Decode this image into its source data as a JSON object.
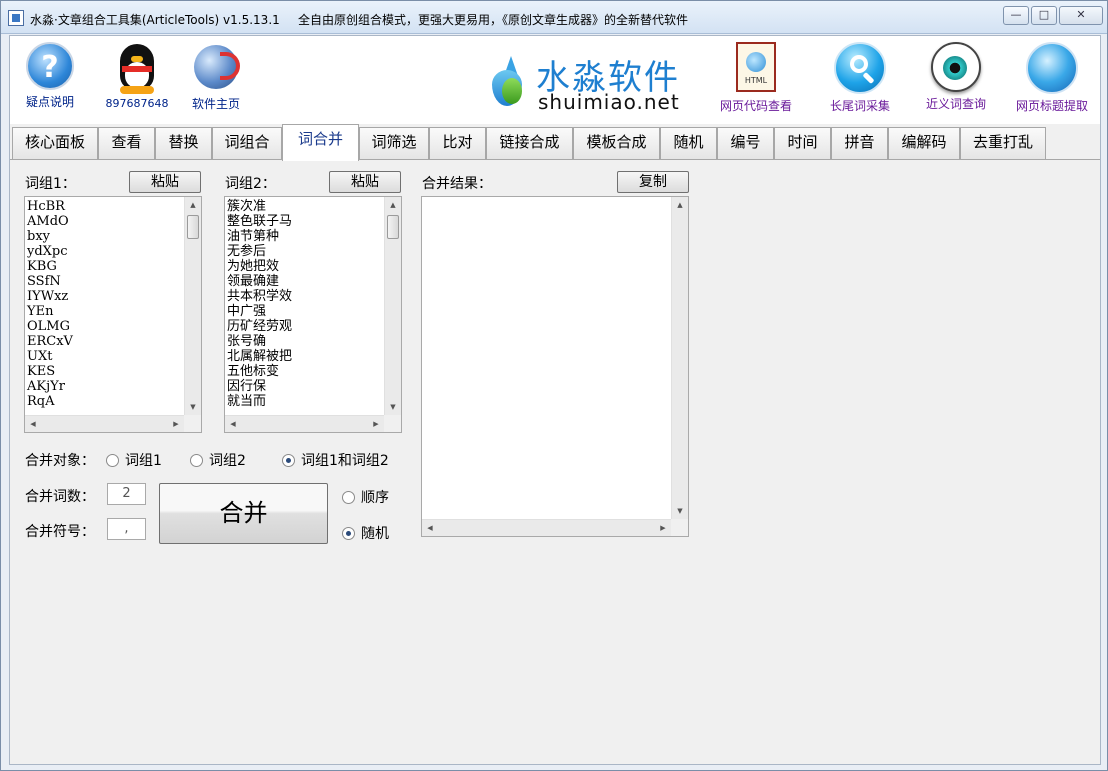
{
  "window": {
    "title": "水淼·文章组合工具集(ArticleTools) v1.5.13.1",
    "slogan": "全自由原创组合模式，更强大更易用，《原创文章生成器》的全新替代软件",
    "minimize": "—",
    "maximize": "□",
    "close": "✕"
  },
  "header": {
    "left_items": [
      {
        "label": "疑点说明",
        "icon": "help-icon"
      },
      {
        "label": "897687648",
        "icon": "qq-penguin-icon"
      },
      {
        "label": "软件主页",
        "icon": "globe-arrow-icon"
      }
    ],
    "logo": {
      "cn": "水淼软件",
      "en": "shuimiao.net"
    },
    "right_items": [
      {
        "label": "网页代码查看",
        "icon": "html-page-icon",
        "icon_text": "HTML"
      },
      {
        "label": "长尾词采集",
        "icon": "magnifier-icon"
      },
      {
        "label": "近义词查询",
        "icon": "eye-icon"
      },
      {
        "label": "网页标题提取",
        "icon": "earth-icon"
      }
    ]
  },
  "tabs": [
    "核心面板",
    "查看",
    "替换",
    "词组合",
    "词合并",
    "词筛选",
    "比对",
    "链接合成",
    "模板合成",
    "随机",
    "编号",
    "时间",
    "拼音",
    "编解码",
    "去重打乱"
  ],
  "active_tab": "词合并",
  "panel": {
    "group1": {
      "label": "词组1：",
      "paste_button": "粘贴",
      "items": [
        "HcBR",
        "AMdO",
        "bxy",
        "ydXpc",
        "KBG",
        "SSfN",
        "IYWxz",
        "YEn",
        "OLMG",
        "ERCxV",
        "UXt",
        "KES",
        "AKjYr",
        "RqA"
      ]
    },
    "group2": {
      "label": "词组2：",
      "paste_button": "粘贴",
      "items": [
        "簇次准",
        "整色联子马",
        "油节第种",
        "无参后",
        "为她把效",
        "领最确建",
        "共本积学效",
        "中广强",
        "历矿经劳观",
        "张号确",
        "北属解被把",
        "五他标变",
        "因行保",
        "就当而"
      ]
    },
    "result": {
      "label": "合并结果：",
      "copy_button": "复制",
      "text": ""
    },
    "merge_target": {
      "label": "合并对象：",
      "options": [
        "词组1",
        "词组2",
        "词组1和词组2"
      ],
      "selected": "词组1和词组2"
    },
    "word_count": {
      "label": "合并词数：",
      "value": "2"
    },
    "separator": {
      "label": "合并符号：",
      "value": ","
    },
    "merge_button": "合并",
    "order": {
      "options": [
        "顺序",
        "随机"
      ],
      "selected": "随机"
    }
  }
}
